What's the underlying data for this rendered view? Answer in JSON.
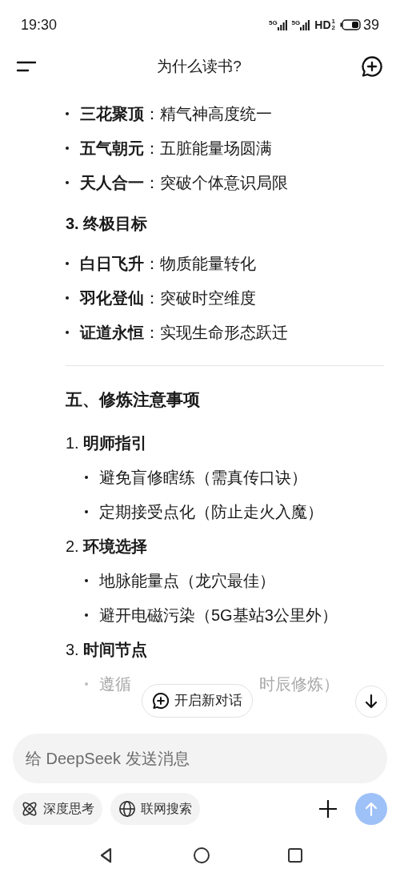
{
  "status_bar": {
    "time": "19:30",
    "sims": [
      "5G",
      "5G"
    ],
    "hd": {
      "label": "HD",
      "sup": "1",
      "sub": "2"
    },
    "battery": "39"
  },
  "header": {
    "title": "为什么读书?"
  },
  "content": [
    {
      "kind": "bullet",
      "label": "三花聚顶",
      "text": "：精气神高度统一"
    },
    {
      "kind": "bullet",
      "label": "五气朝元",
      "text": "：五脏能量场圆满"
    },
    {
      "kind": "bullet",
      "label": "天人合一",
      "text": "：突破个体意识局限"
    },
    {
      "kind": "heading",
      "text": "3. 终极目标"
    },
    {
      "kind": "bullet",
      "label": "白日飞升",
      "text": "：物质能量转化"
    },
    {
      "kind": "bullet",
      "label": "羽化登仙",
      "text": "：突破时空维度"
    },
    {
      "kind": "bullet",
      "label": "证道永恒",
      "text": "：实现生命形态跃迁"
    },
    {
      "kind": "divider"
    },
    {
      "kind": "section",
      "text": "五、修炼注意事项"
    },
    {
      "kind": "numbered",
      "number": "1.",
      "label": "明师指引",
      "children": [
        "避免盲修瞎练（需真传口诀）",
        "定期接受点化（防止走火入魔）"
      ]
    },
    {
      "kind": "numbered",
      "number": "2.",
      "label": "环境选择",
      "children": [
        "地脉能量点（龙穴最佳）",
        "避开电磁污染（5G基站3公里外）"
      ]
    },
    {
      "kind": "numbered",
      "number": "3.",
      "label": "时间节点"
    },
    {
      "kind": "partial_bullet",
      "before": "遵循",
      "after": "时辰修炼）"
    }
  ],
  "new_chat_button": "开启新对话",
  "composer": {
    "placeholder": "给 DeepSeek 发送消息",
    "chips": [
      {
        "label": "深度思考",
        "selected": false
      },
      {
        "label": "联网搜索",
        "selected": false
      }
    ]
  }
}
